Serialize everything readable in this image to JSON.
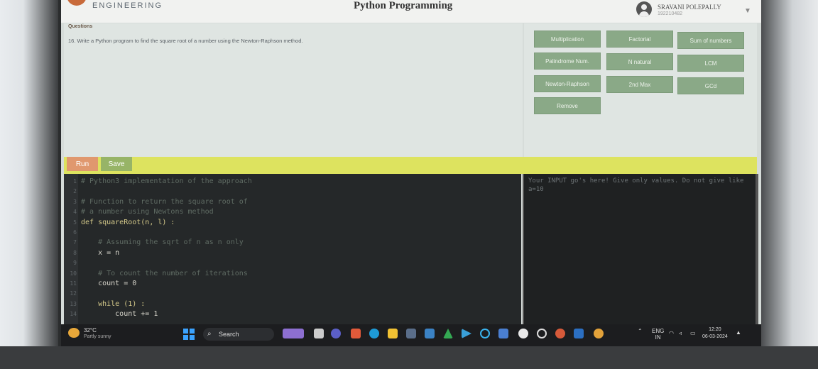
{
  "header": {
    "logo_text": "ENGINEERING",
    "app_title": "Python Programming",
    "user_name": "SRAVANI POLEPALLY",
    "user_id": "192210482"
  },
  "question": {
    "heading": "Questions",
    "text": "16. Write a Python program to find the square root of a number using the Newton-Raphson method."
  },
  "programs": [
    {
      "label": "Multiplication"
    },
    {
      "label": "Factorial"
    },
    {
      "label": "Sum of numbers"
    },
    {
      "label": "Palindrome Num."
    },
    {
      "label": "N natural"
    },
    {
      "label": "LCM"
    },
    {
      "label": "Newton-Raphson"
    },
    {
      "label": "2nd Max"
    },
    {
      "label": "GCd"
    },
    {
      "label": "Remove"
    }
  ],
  "toolbar": {
    "run_label": "Run",
    "save_label": "Save"
  },
  "editor": {
    "lines": [
      {
        "n": "1",
        "code": "# Python3 implementation of the approach"
      },
      {
        "n": "2",
        "code": ""
      },
      {
        "n": "3",
        "code": "# Function to return the square root of"
      },
      {
        "n": "4",
        "code": "# a number using Newtons method"
      },
      {
        "n": "5",
        "code": "def squareRoot(n, l) :"
      },
      {
        "n": "6",
        "code": ""
      },
      {
        "n": "7",
        "code": "    # Assuming the sqrt of n as n only"
      },
      {
        "n": "8",
        "code": "    x = n"
      },
      {
        "n": "9",
        "code": ""
      },
      {
        "n": "10",
        "code": "    # To count the number of iterations"
      },
      {
        "n": "11",
        "code": "    count = 0"
      },
      {
        "n": "12",
        "code": ""
      },
      {
        "n": "13",
        "code": "    while (1) :"
      },
      {
        "n": "14",
        "code": "        count += 1"
      }
    ]
  },
  "input_panel": {
    "placeholder": "Your INPUT go's here! Give only values. Do not give like a=10"
  },
  "taskbar": {
    "temperature": "32°C",
    "weather": "Partly sunny",
    "search_label": "Search",
    "lang": "ENG",
    "region": "IN",
    "time": "12:20",
    "date": "06-03-2024"
  },
  "colors": {
    "program_button": "#8aa987",
    "run_button": "#e0986e",
    "save_button": "#97b467",
    "run_bar": "#dde35f",
    "editor_bg": "#252829"
  }
}
